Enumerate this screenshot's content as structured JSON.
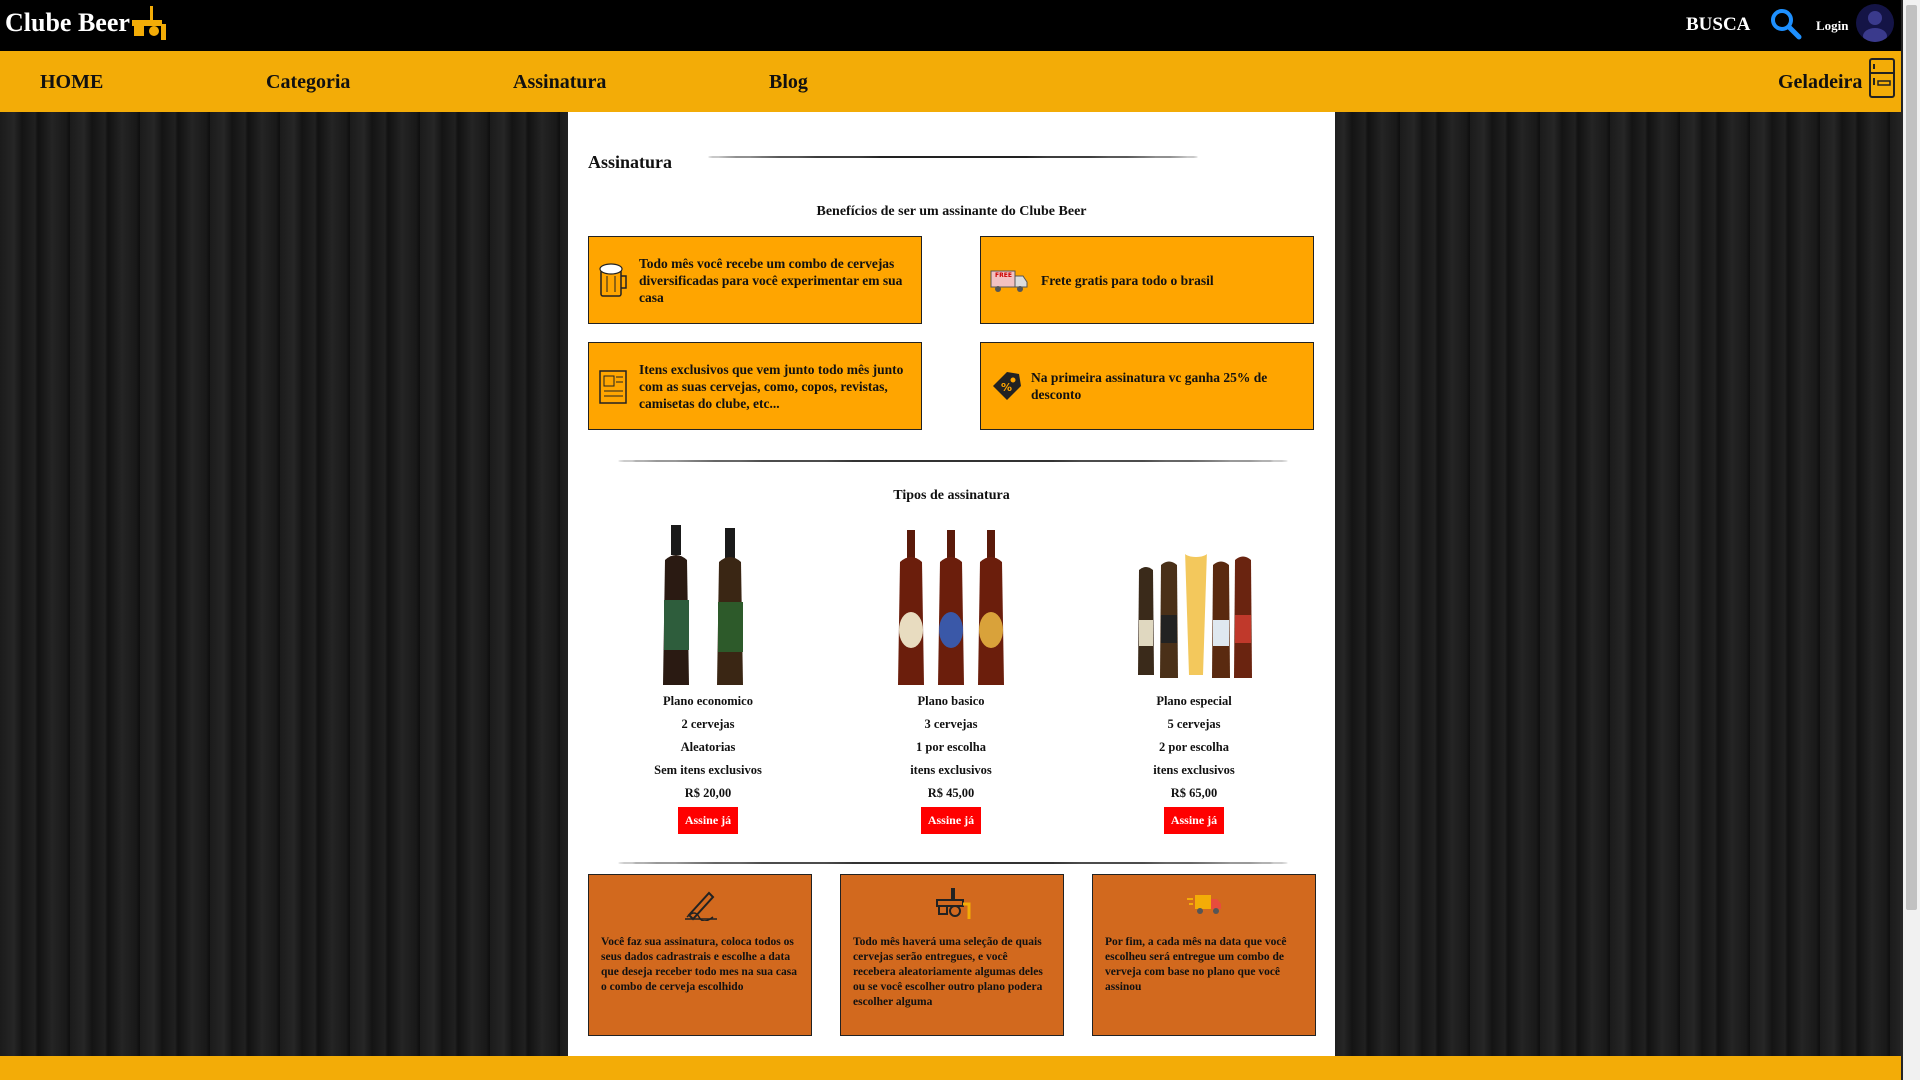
{
  "header": {
    "logo_text": "Clube Beer",
    "search_label": "BUSCA",
    "login_label": "Login"
  },
  "nav": {
    "items": [
      "HOME",
      "Categoria",
      "Assinatura",
      "Blog"
    ],
    "fridge_label": "Geladeira"
  },
  "page": {
    "section_title": "Assinatura",
    "benefits_title": "Benefícios de ser um assinante do Clube Beer",
    "benefits": [
      {
        "icon": "beer-mug-icon",
        "text": "Todo mês você recebe um combo de cervejas diversificadas para você experimentar em sua casa"
      },
      {
        "icon": "free-delivery-truck-icon",
        "text": "Frete gratis para todo o brasil"
      },
      {
        "icon": "newspaper-icon",
        "text": "Itens exclusivos que vem junto todo mês junto com as suas cervejas, como, copos, revistas, camisetas do clube, etc..."
      },
      {
        "icon": "discount-tag-icon",
        "text": "Na primeira assinatura vc ganha 25% de desconto"
      }
    ],
    "plans_title": "Tipos de assinatura",
    "plans": [
      {
        "name": "Plano economico",
        "beers": "2 cervejas",
        "choice": "Aleatorias",
        "items": "Sem itens exclusivos",
        "price": "R$ 20,00",
        "button": "Assine já"
      },
      {
        "name": "Plano basico",
        "beers": "3 cervejas",
        "choice": "1 por escolha",
        "items": "itens exclusivos",
        "price": "R$ 45,00",
        "button": "Assine já"
      },
      {
        "name": "Plano especial",
        "beers": "5 cervejas",
        "choice": "2 por escolha",
        "items": "itens exclusivos",
        "price": "R$ 65,00",
        "button": "Assine já"
      }
    ],
    "steps": [
      {
        "icon": "signature-pen-icon",
        "text": "Você faz sua assinatura, coloca todos os seus dados cadrastrais e escolhe a data que deseja receber todo mes na sua casa o combo de cerveja escolhido"
      },
      {
        "icon": "beer-tap-icon",
        "text": "Todo mês haverá uma seleção de quais cervejas serão entregues, e você recebera aleatoriamente algumas deles ou se você escolher outro plano podera escolher alguma"
      },
      {
        "icon": "delivery-truck-icon",
        "text": "Por fim, a cada mês na data que você escolheu será entregue um combo de verveja com base no plano que você assinou"
      }
    ]
  },
  "colors": {
    "nav_bg": "#f3ac07",
    "benefit_bg": "#ffa500",
    "step_bg": "#d2691e",
    "button_bg": "#ff0000"
  }
}
